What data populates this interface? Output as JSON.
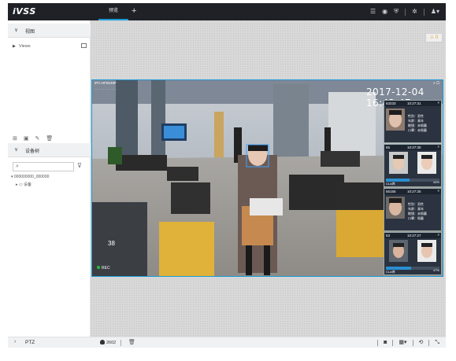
{
  "app": {
    "logo": "iVSS"
  },
  "tabs": [
    {
      "label": "预览",
      "active": true
    }
  ],
  "tab_add": "+",
  "header_icons": [
    "list-icon",
    "globe-icon",
    "shield-icon",
    "settings-icon",
    "user-icon"
  ],
  "sidebar": {
    "view_section": {
      "title": "视图",
      "tree_item": "Views"
    },
    "device_section": {
      "title": "设备树",
      "tree_root": "000000000_000000",
      "tree_child": "设备"
    },
    "ptz_title": "PTZ"
  },
  "warning_badge": "⚠ 0",
  "video": {
    "camera_name": "IPC-HF8249F",
    "camera_sub": "...... ..... ..... ......",
    "timestamp": "2017-12-04 16:42:47",
    "osd_number": "38",
    "rec_label": "REC"
  },
  "face_cards": [
    {
      "id": "63233",
      "time": "10:27:31",
      "info": [
        "性别：男性",
        "年龄：青年",
        "眼镜：未佩戴",
        "口罩：未佩戴"
      ],
      "tag": ""
    },
    {
      "id": "65",
      "time": "10:27:30",
      "info": [],
      "tag": "CLA库",
      "percent": "44%",
      "similarity": 0.44
    },
    {
      "id": "55155",
      "time": "10:27:25",
      "info": [
        "性别：男性",
        "年龄：青年",
        "眼镜：未佩戴",
        "口罩：佩戴"
      ],
      "tag": ""
    },
    {
      "id": "53",
      "time": "10:27:27",
      "info": [],
      "tag": "CLA库",
      "percent": "47%",
      "similarity": 0.47
    }
  ],
  "bottom": {
    "user": "2602"
  },
  "colors": {
    "accent": "#1b9ad6",
    "topbar": "#1f2127",
    "rec": "#23c23a"
  }
}
